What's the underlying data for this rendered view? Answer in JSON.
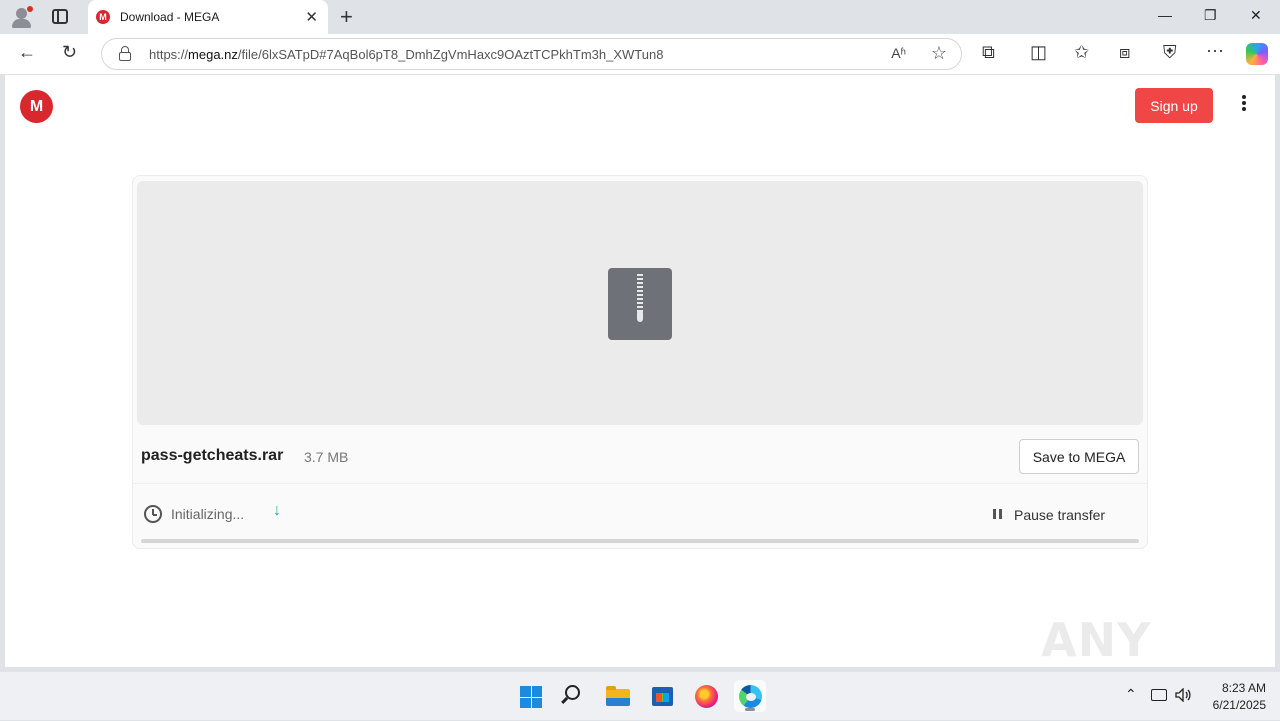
{
  "browser": {
    "tab_title": "Download - MEGA",
    "url_prefix": "https://",
    "url_domain": "mega.nz",
    "url_path": "/file/6lxSATpD#7AqBol6pT8_DmhZgVmHaxc9OAztTCPkhTm3h_XWTun8",
    "new_tab_label": "+",
    "tab_close_label": "✕",
    "back_label": "←",
    "reload_label": "↻",
    "minimize_label": "—",
    "restore_label": "❐",
    "close_label": "✕",
    "read_aloud_label": "Aʱ",
    "favorite_label": "☆",
    "extensions_label": "⧉",
    "split_label": "◫",
    "favorites_label": "✩",
    "collections_label": "⧈",
    "shield_label": "⛨",
    "more_label": "···"
  },
  "page": {
    "logo_letter": "M",
    "signup_label": "Sign up",
    "file_name": "pass-getcheats.rar",
    "file_size": "3.7 MB",
    "save_label": "Save to MEGA",
    "status_text": "Initializing...",
    "download_arrow": "↓",
    "pause_label": "Pause transfer",
    "progress_fraction": 0.0,
    "accent_color": "#d9272e",
    "progress_color": "#16b1a6"
  },
  "watermark": "ANY RUN",
  "taskbar": {
    "tray_chevron": "⌃",
    "time": "8:23 AM",
    "date": "6/21/2025"
  },
  "icons": [
    "windows-start-icon",
    "search-icon",
    "file-explorer-icon",
    "store-icon",
    "firefox-icon",
    "edge-icon",
    "zip-file-icon",
    "clock-icon",
    "pause-icon"
  ]
}
